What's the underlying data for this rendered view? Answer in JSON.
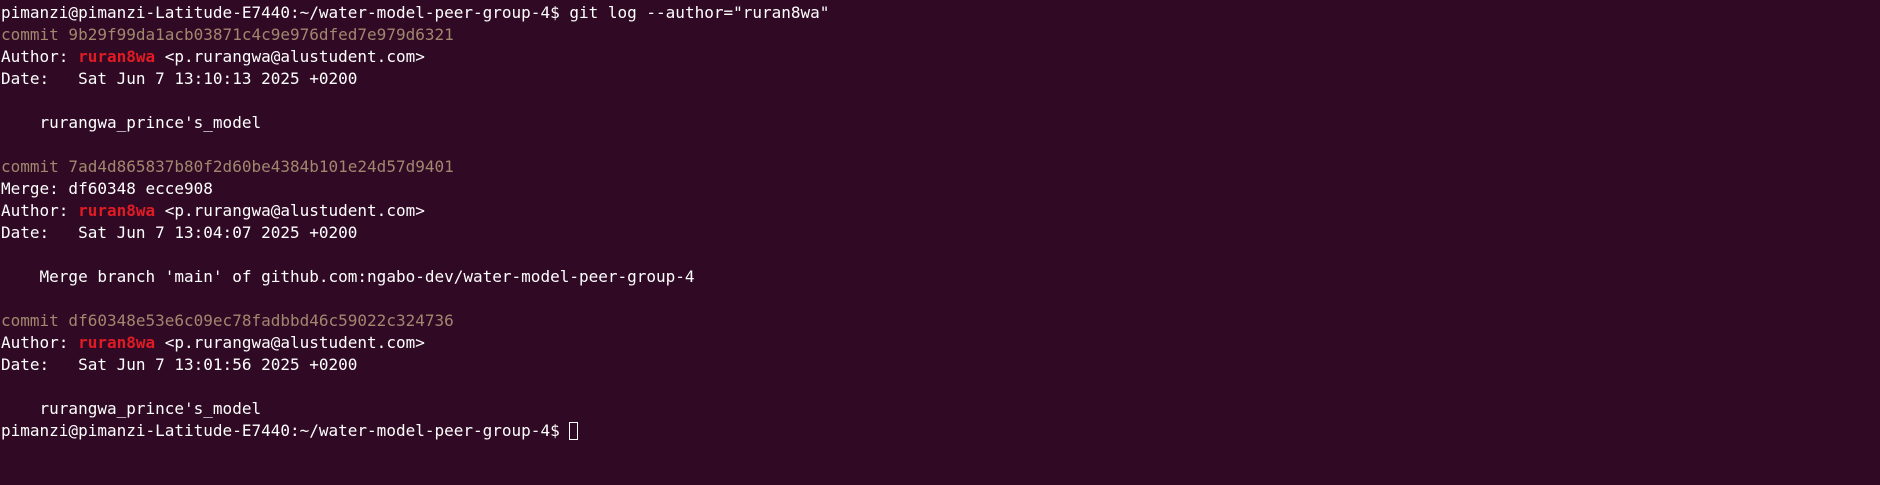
{
  "terminal": {
    "prompt": "pimanzi@pimanzi-Latitude-E7440:~/water-model-peer-group-4$ ",
    "command": "git log --author=\"ruran8wa\"",
    "commits": [
      {
        "commit_line": "commit 9b29f99da1acb03871c4c9e976dfed7e979d6321",
        "merge_line": "",
        "author_label": "Author: ",
        "author_name": "ruran8wa",
        "author_email": " <p.rurangwa@alustudent.com>",
        "date_line": "Date:   Sat Jun 7 13:10:13 2025 +0200",
        "message": "    rurangwa_prince's_model"
      },
      {
        "commit_line": "commit 7ad4d865837b80f2d60be4384b101e24d57d9401",
        "merge_line": "Merge: df60348 ecce908",
        "author_label": "Author: ",
        "author_name": "ruran8wa",
        "author_email": " <p.rurangwa@alustudent.com>",
        "date_line": "Date:   Sat Jun 7 13:04:07 2025 +0200",
        "message": "    Merge branch 'main' of github.com:ngabo-dev/water-model-peer-group-4"
      },
      {
        "commit_line": "commit df60348e53e6c09ec78fadbbd46c59022c324736",
        "merge_line": "",
        "author_label": "Author: ",
        "author_name": "ruran8wa",
        "author_email": " <p.rurangwa@alustudent.com>",
        "date_line": "Date:   Sat Jun 7 13:01:56 2025 +0200",
        "message": "    rurangwa_prince's_model"
      }
    ],
    "final_prompt": "pimanzi@pimanzi-Latitude-E7440:~/water-model-peer-group-4$ ",
    "colors": {
      "background": "#300a24",
      "text": "#ffffff",
      "commit_hash": "#a0876e",
      "author_highlight": "#e01b24"
    }
  }
}
